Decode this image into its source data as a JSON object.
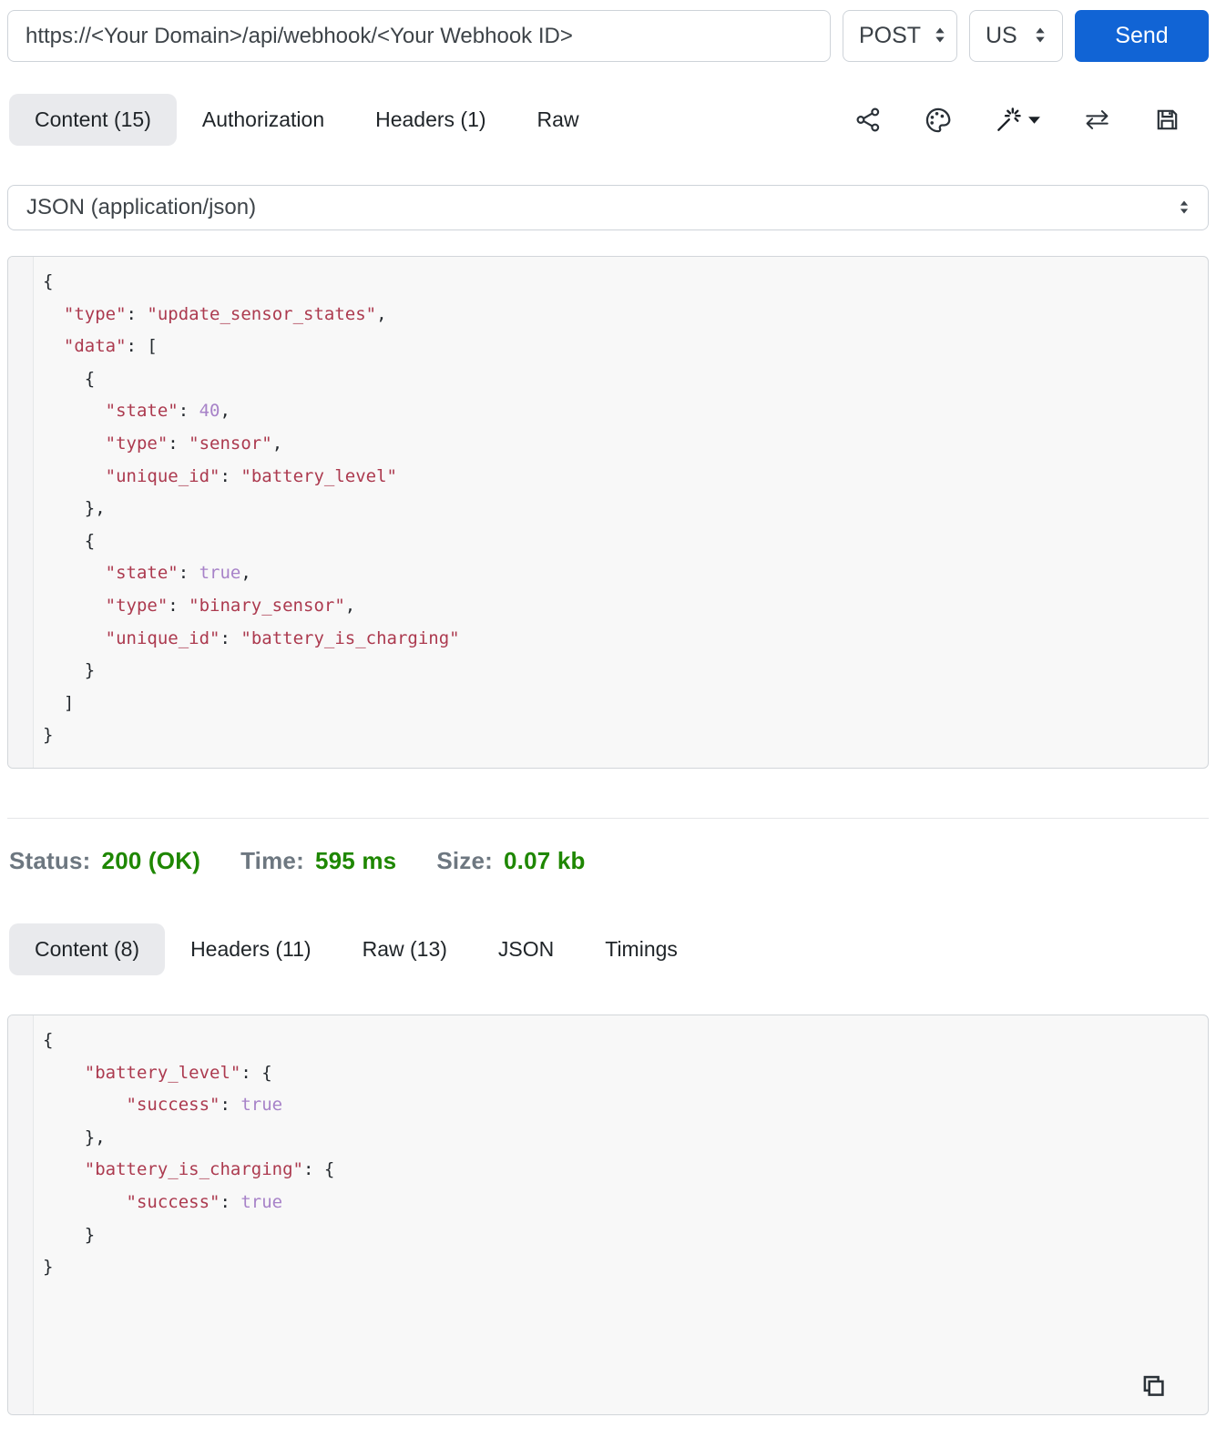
{
  "request_bar": {
    "url": "https://<Your Domain>/api/webhook/<Your Webhook ID>",
    "method": "POST",
    "region": "US",
    "send_label": "Send"
  },
  "request_tabs": [
    {
      "label": "Content (15)",
      "active": true
    },
    {
      "label": "Authorization",
      "active": false
    },
    {
      "label": "Headers (1)",
      "active": false
    },
    {
      "label": "Raw",
      "active": false
    }
  ],
  "toolbar_icons": [
    "share",
    "palette",
    "magic-wand-menu",
    "swap-arrows",
    "save"
  ],
  "content_type_selector": {
    "selected": "JSON (application/json)"
  },
  "request_body_lines": [
    [
      {
        "t": "p",
        "v": "{"
      }
    ],
    [
      {
        "t": "p",
        "v": "  "
      },
      {
        "t": "s",
        "v": "\"type\""
      },
      {
        "t": "p",
        "v": ": "
      },
      {
        "t": "s",
        "v": "\"update_sensor_states\""
      },
      {
        "t": "p",
        "v": ","
      }
    ],
    [
      {
        "t": "p",
        "v": "  "
      },
      {
        "t": "s",
        "v": "\"data\""
      },
      {
        "t": "p",
        "v": ": ["
      }
    ],
    [
      {
        "t": "p",
        "v": "    {"
      }
    ],
    [
      {
        "t": "p",
        "v": "      "
      },
      {
        "t": "s",
        "v": "\"state\""
      },
      {
        "t": "p",
        "v": ": "
      },
      {
        "t": "n",
        "v": "40"
      },
      {
        "t": "p",
        "v": ","
      }
    ],
    [
      {
        "t": "p",
        "v": "      "
      },
      {
        "t": "s",
        "v": "\"type\""
      },
      {
        "t": "p",
        "v": ": "
      },
      {
        "t": "s",
        "v": "\"sensor\""
      },
      {
        "t": "p",
        "v": ","
      }
    ],
    [
      {
        "t": "p",
        "v": "      "
      },
      {
        "t": "s",
        "v": "\"unique_id\""
      },
      {
        "t": "p",
        "v": ": "
      },
      {
        "t": "s",
        "v": "\"battery_level\""
      }
    ],
    [
      {
        "t": "p",
        "v": "    },"
      }
    ],
    [
      {
        "t": "p",
        "v": "    {"
      }
    ],
    [
      {
        "t": "p",
        "v": "      "
      },
      {
        "t": "s",
        "v": "\"state\""
      },
      {
        "t": "p",
        "v": ": "
      },
      {
        "t": "n",
        "v": "true"
      },
      {
        "t": "p",
        "v": ","
      }
    ],
    [
      {
        "t": "p",
        "v": "      "
      },
      {
        "t": "s",
        "v": "\"type\""
      },
      {
        "t": "p",
        "v": ": "
      },
      {
        "t": "s",
        "v": "\"binary_sensor\""
      },
      {
        "t": "p",
        "v": ","
      }
    ],
    [
      {
        "t": "p",
        "v": "      "
      },
      {
        "t": "s",
        "v": "\"unique_id\""
      },
      {
        "t": "p",
        "v": ": "
      },
      {
        "t": "s",
        "v": "\"battery_is_charging\""
      }
    ],
    [
      {
        "t": "p",
        "v": "    }"
      }
    ],
    [
      {
        "t": "p",
        "v": "  ]"
      }
    ],
    [
      {
        "t": "p",
        "v": "}"
      }
    ]
  ],
  "status_bar": {
    "status_label": "Status:",
    "status_value": "200 (OK)",
    "time_label": "Time:",
    "time_value": "595 ms",
    "size_label": "Size:",
    "size_value": "0.07 kb"
  },
  "response_tabs": [
    {
      "label": "Content (8)",
      "active": true
    },
    {
      "label": "Headers (11)",
      "active": false
    },
    {
      "label": "Raw (13)",
      "active": false
    },
    {
      "label": "JSON",
      "active": false
    },
    {
      "label": "Timings",
      "active": false
    }
  ],
  "response_body_lines": [
    [
      {
        "t": "p",
        "v": "{"
      }
    ],
    [
      {
        "t": "p",
        "v": "    "
      },
      {
        "t": "s",
        "v": "\"battery_level\""
      },
      {
        "t": "p",
        "v": ": {"
      }
    ],
    [
      {
        "t": "p",
        "v": "        "
      },
      {
        "t": "s",
        "v": "\"success\""
      },
      {
        "t": "p",
        "v": ": "
      },
      {
        "t": "n",
        "v": "true"
      }
    ],
    [
      {
        "t": "p",
        "v": "    },"
      }
    ],
    [
      {
        "t": "p",
        "v": "    "
      },
      {
        "t": "s",
        "v": "\"battery_is_charging\""
      },
      {
        "t": "p",
        "v": ": {"
      }
    ],
    [
      {
        "t": "p",
        "v": "        "
      },
      {
        "t": "s",
        "v": "\"success\""
      },
      {
        "t": "p",
        "v": ": "
      },
      {
        "t": "n",
        "v": "true"
      }
    ],
    [
      {
        "t": "p",
        "v": "    }"
      }
    ],
    [
      {
        "t": "p",
        "v": "}"
      }
    ]
  ],
  "response_toolbar_icons": [
    "copy"
  ],
  "colors": {
    "accent_blue": "#1164d5",
    "status_green": "#1e8700",
    "label_gray": "#6d7780",
    "code_string_red": "#ac3a4f",
    "code_literal_purple": "#a782c8",
    "active_tab_bg": "#e9eaed"
  }
}
